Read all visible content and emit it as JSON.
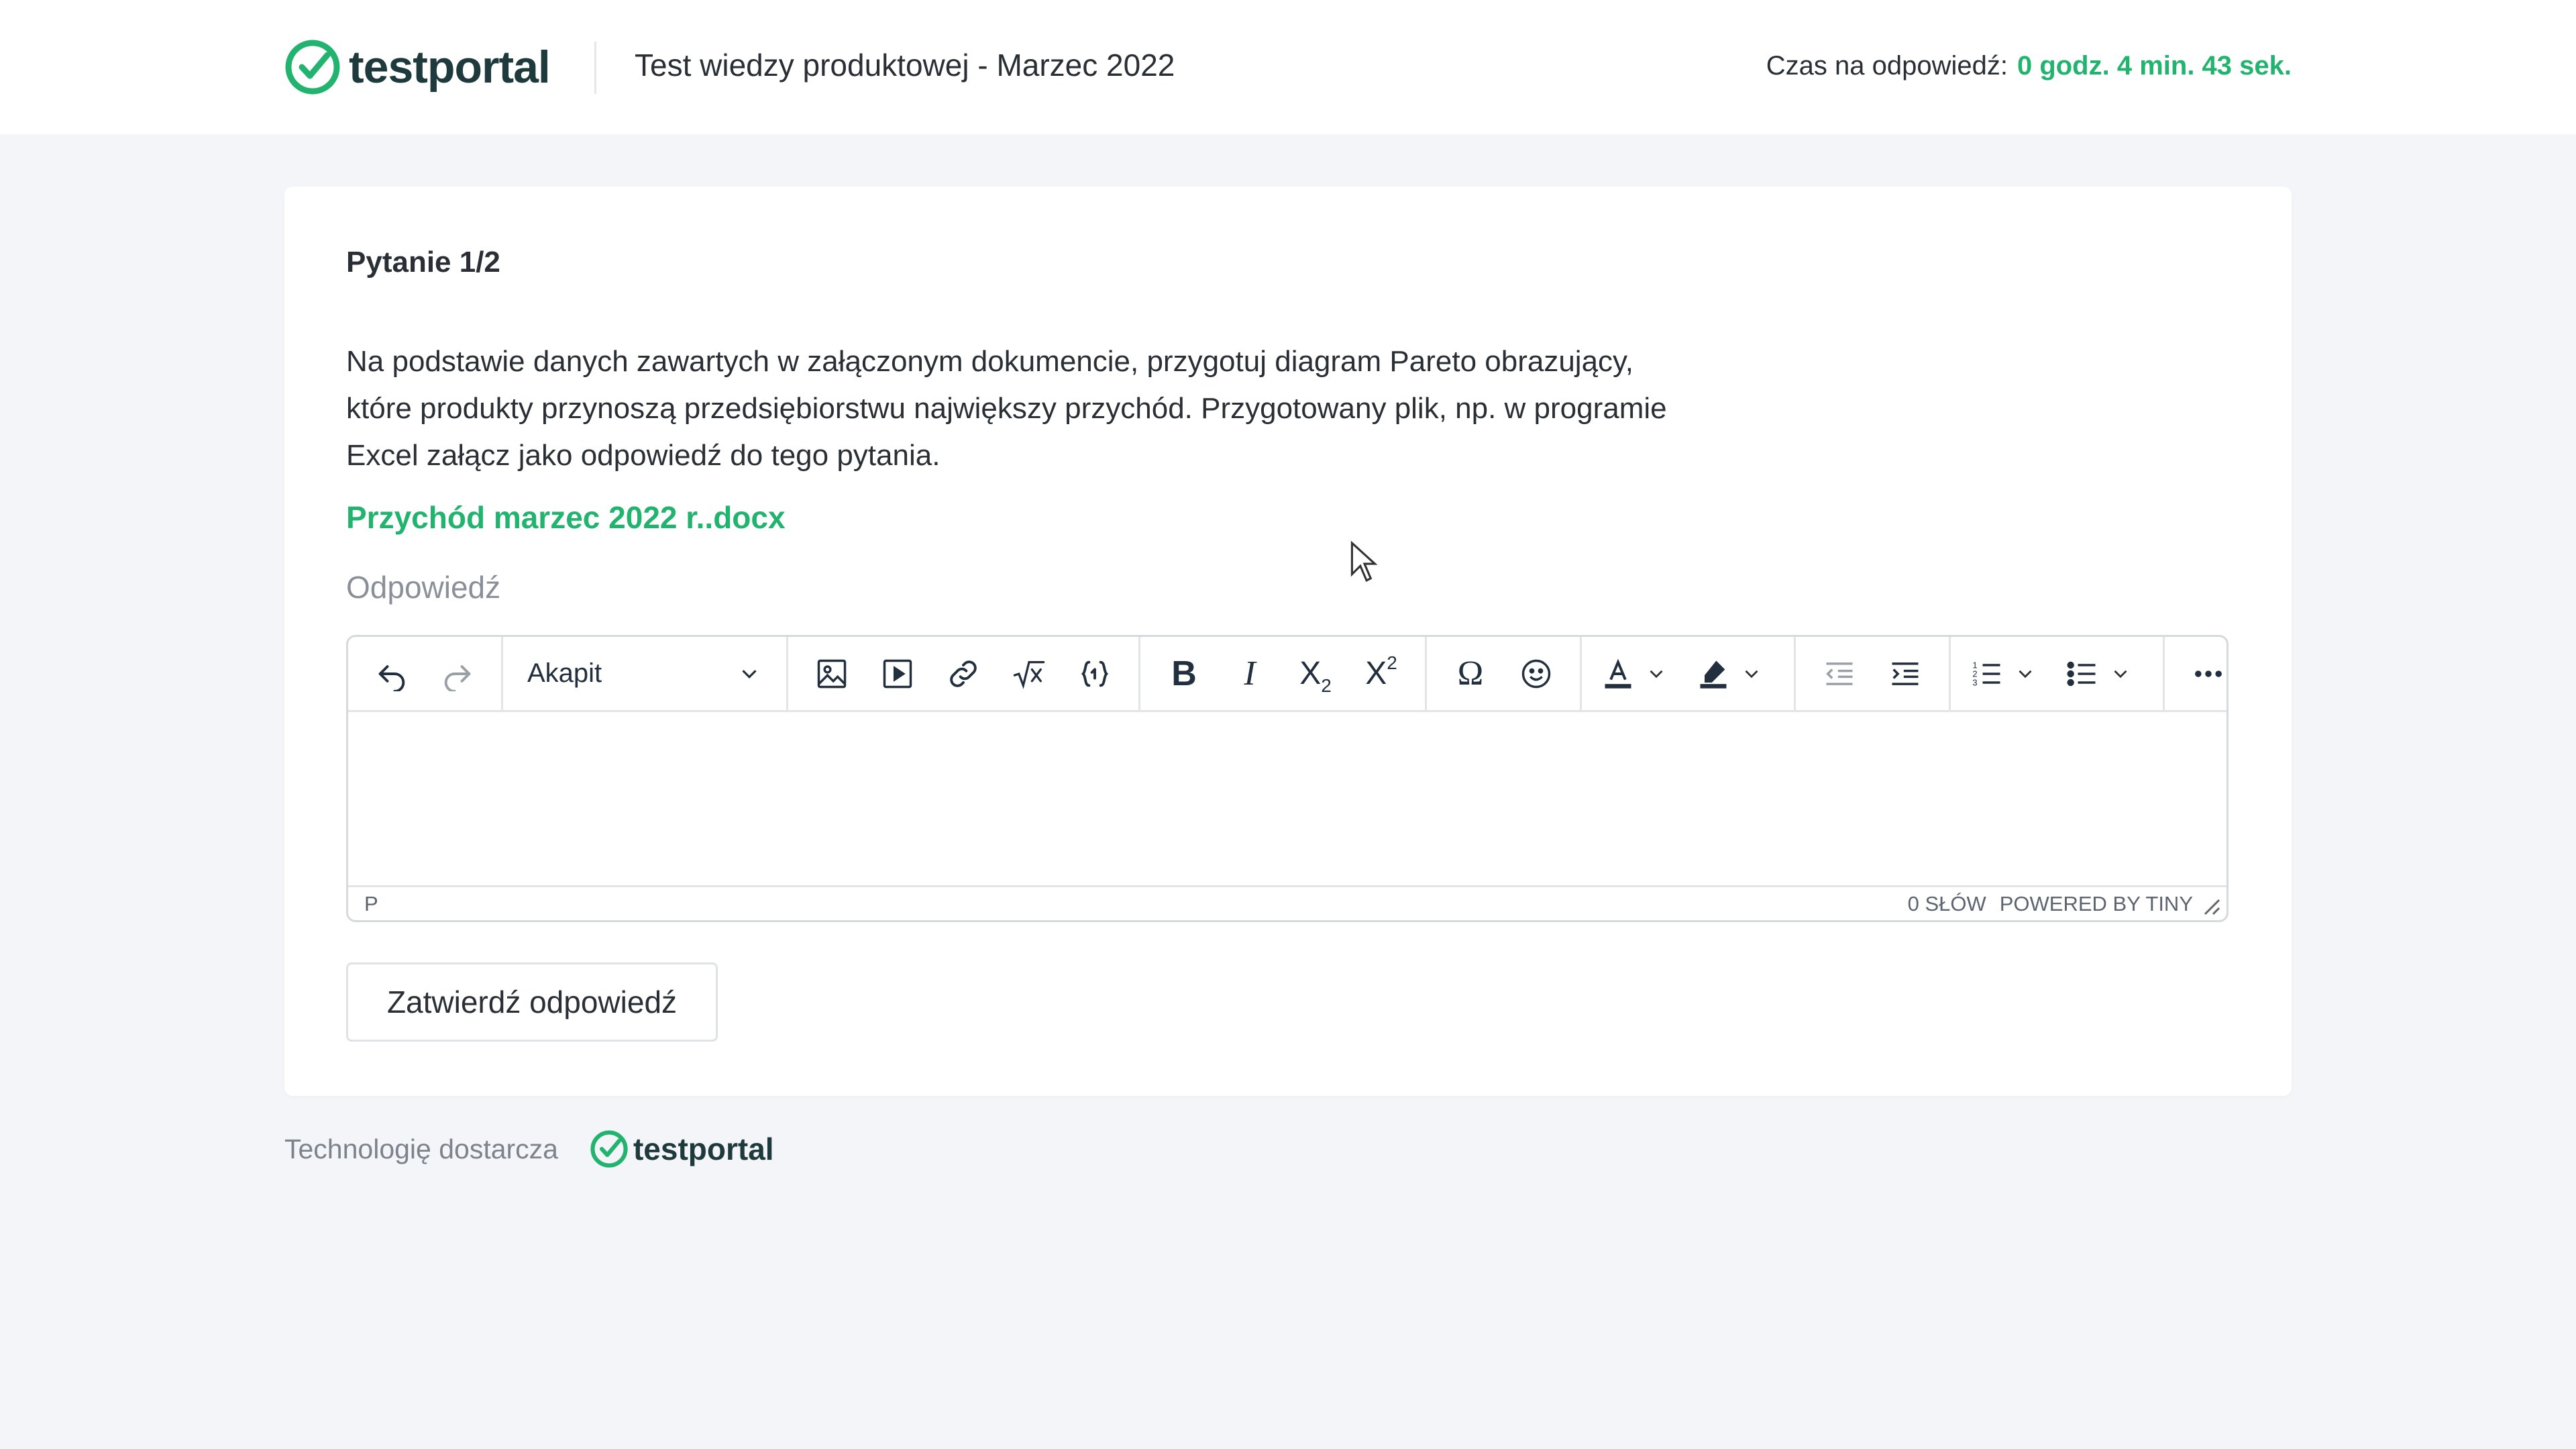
{
  "header": {
    "logo_text": "testportal",
    "test_title": "Test wiedzy produktowej - Marzec 2022",
    "timer_label": "Czas na odpowiedź:",
    "timer_value": "0 godz. 4 min. 43 sek."
  },
  "question": {
    "number": "Pytanie 1/2",
    "text": "Na podstawie danych zawartych w załączonym dokumencie, przygotuj diagram Pareto obrazujący, które produkty przynoszą przedsiębiorstwu największy przychód. Przygotowany plik, np. w programie Excel załącz jako odpowiedź do tego pytania.",
    "attachment": "Przychód marzec 2022 r..docx",
    "answer_label": "Odpowiedź"
  },
  "editor": {
    "block_format": "Akapit",
    "status_path": "P",
    "word_count": "0 SŁÓW",
    "powered_by": "POWERED BY TINY",
    "toolbar_icons": [
      "undo-icon",
      "redo-icon",
      "image-icon",
      "media-icon",
      "link-icon",
      "math-icon",
      "code-icon",
      "bold-icon",
      "italic-icon",
      "subscript-icon",
      "superscript-icon",
      "omega-icon",
      "emoji-icon",
      "text-color-icon",
      "highlight-icon",
      "outdent-icon",
      "indent-icon",
      "numbered-list-icon",
      "bullet-list-icon",
      "more-icon"
    ],
    "text_color_accent": "#222f3e"
  },
  "submit_label": "Zatwierdź odpowiedź",
  "footer": {
    "label": "Technologię dostarcza",
    "logo_text": "testportal"
  },
  "colors": {
    "accent_green": "#22b46e",
    "background": "#f4f5f8",
    "text": "#2a2f36"
  }
}
